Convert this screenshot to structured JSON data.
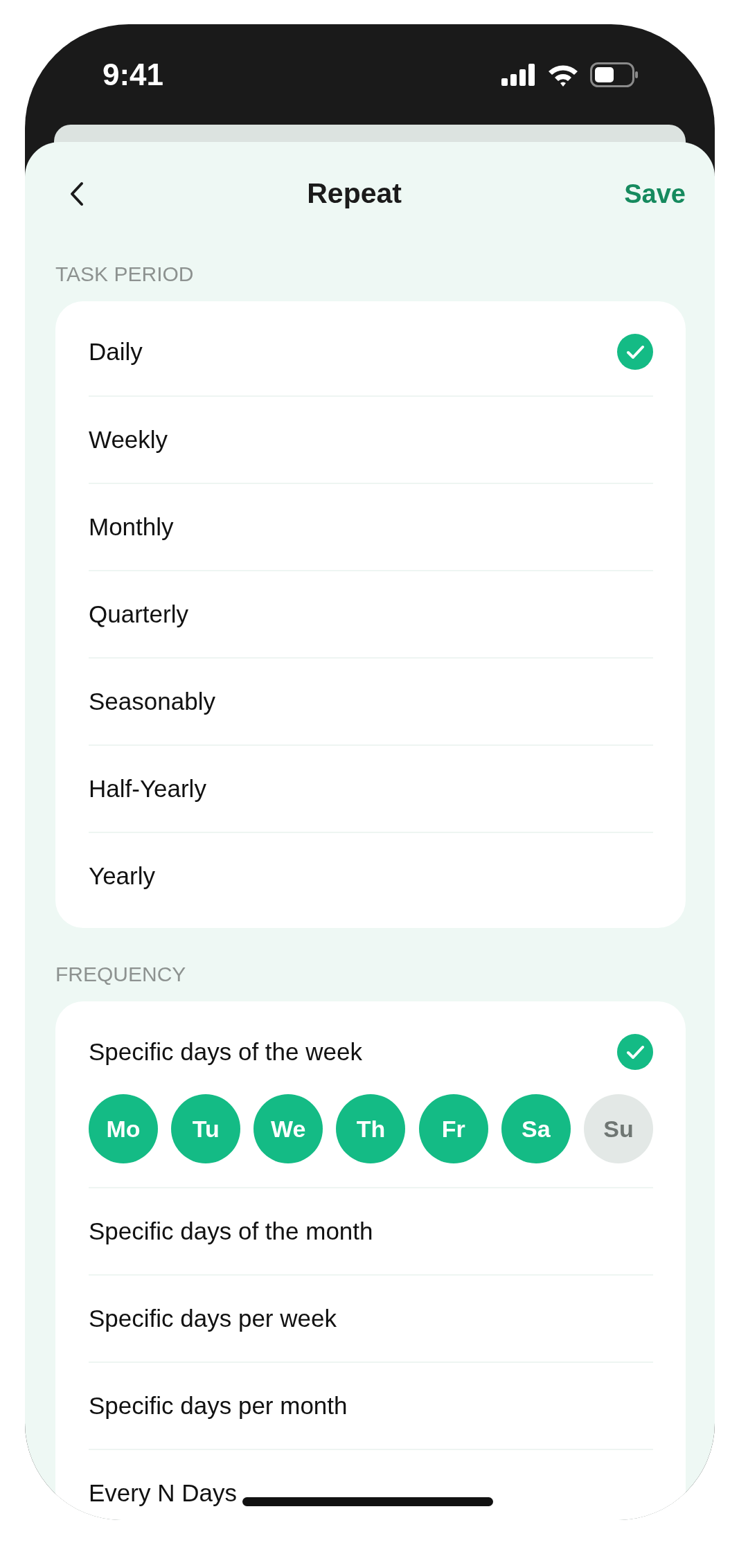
{
  "status_bar": {
    "time": "9:41"
  },
  "header": {
    "title": "Repeat",
    "action": "Save"
  },
  "task_period": {
    "label": "TASK PERIOD",
    "options": [
      {
        "label": "Daily",
        "selected": true
      },
      {
        "label": "Weekly",
        "selected": false
      },
      {
        "label": "Monthly",
        "selected": false
      },
      {
        "label": "Quarterly",
        "selected": false
      },
      {
        "label": "Seasonably",
        "selected": false
      },
      {
        "label": "Half-Yearly",
        "selected": false
      },
      {
        "label": "Yearly",
        "selected": false
      }
    ]
  },
  "frequency": {
    "label": "FREQUENCY",
    "options": [
      {
        "label": "Specific days of the week",
        "selected": true,
        "days": [
          {
            "label": "Mo",
            "selected": true
          },
          {
            "label": "Tu",
            "selected": true
          },
          {
            "label": "We",
            "selected": true
          },
          {
            "label": "Th",
            "selected": true
          },
          {
            "label": "Fr",
            "selected": true
          },
          {
            "label": "Sa",
            "selected": true
          },
          {
            "label": "Su",
            "selected": false
          }
        ]
      },
      {
        "label": "Specific days of the month",
        "selected": false
      },
      {
        "label": "Specific days per week",
        "selected": false
      },
      {
        "label": "Specific days per month",
        "selected": false
      },
      {
        "label": "Every N Days",
        "selected": false
      }
    ]
  }
}
